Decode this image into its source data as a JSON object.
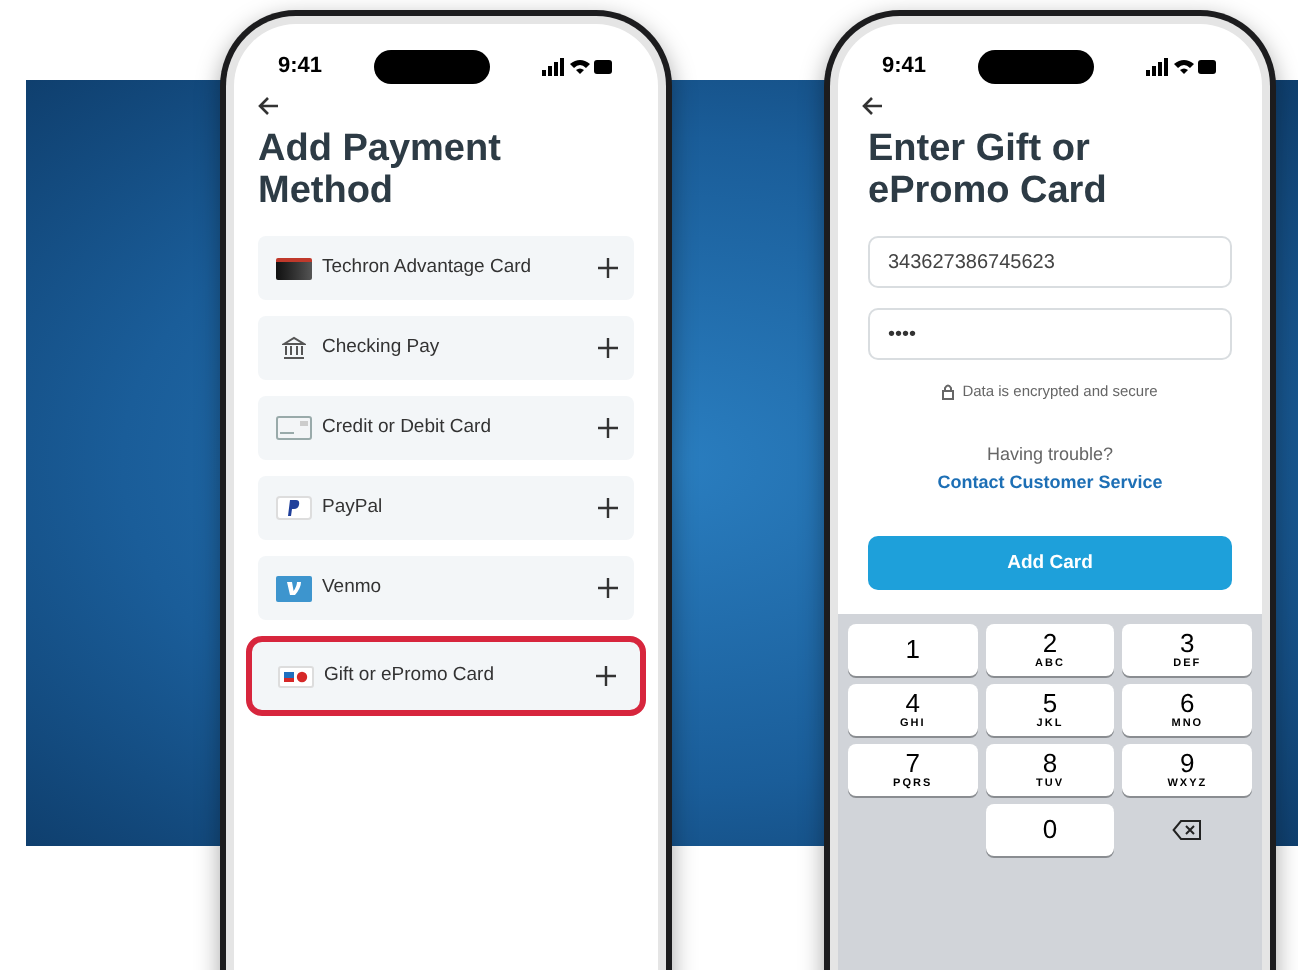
{
  "phones": [
    {
      "time": "9:41",
      "title": "Add Payment Method",
      "methods": [
        {
          "kind": "techron",
          "label": "Techron Advantage Card",
          "highlighted": false
        },
        {
          "kind": "bank",
          "label": "Checking Pay",
          "highlighted": false
        },
        {
          "kind": "card",
          "label": "Credit or Debit Card",
          "highlighted": false
        },
        {
          "kind": "paypal",
          "label": "PayPal",
          "highlighted": false
        },
        {
          "kind": "venmo",
          "label": "Venmo",
          "highlighted": false
        },
        {
          "kind": "gift",
          "label": "Gift or ePromo Card",
          "highlighted": true
        }
      ]
    },
    {
      "time": "9:41",
      "title": "Enter Gift or ePromo Card",
      "card_number": "343627386745623",
      "pin": "••••",
      "security_note": "Data is encrypted and secure",
      "help_text": "Having trouble?",
      "help_link": "Contact Customer Service",
      "submit": "Add Card",
      "keypad": [
        {
          "digit": "1"
        },
        {
          "digit": "2",
          "letters": "ABC"
        },
        {
          "digit": "3",
          "letters": "DEF"
        },
        {
          "digit": "4",
          "letters": "GHI"
        },
        {
          "digit": "5",
          "letters": "JKL"
        },
        {
          "digit": "6",
          "letters": "MNO"
        },
        {
          "digit": "7",
          "letters": "PQRS"
        },
        {
          "digit": "8",
          "letters": "TUV"
        },
        {
          "digit": "9",
          "letters": "WXYZ"
        },
        {
          "digit": "0"
        }
      ]
    }
  ]
}
